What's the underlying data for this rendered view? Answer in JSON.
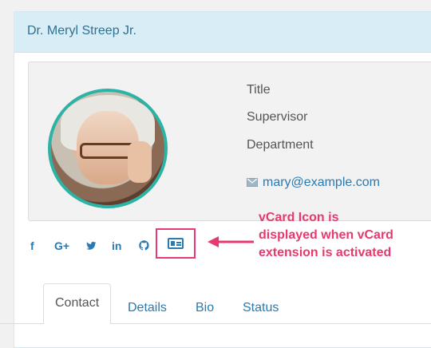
{
  "panel": {
    "title": "Dr. Meryl Streep Jr."
  },
  "profile": {
    "lines": [
      "Title",
      "Supervisor",
      "Department"
    ],
    "email": "mary@example.com"
  },
  "social_icons": [
    "facebook-icon",
    "google-plus-icon",
    "twitter-icon",
    "linkedin-icon",
    "github-icon",
    "vcard-icon"
  ],
  "annotation": {
    "line1": "vCard Icon is",
    "line2": "displayed when vCard",
    "line3": "extension is activated"
  },
  "tabs": [
    "Contact",
    "Details",
    "Bio",
    "Status"
  ],
  "colors": {
    "accent": "#2a7ab0",
    "highlight": "#e53a6d",
    "ring": "#2db3a6"
  }
}
